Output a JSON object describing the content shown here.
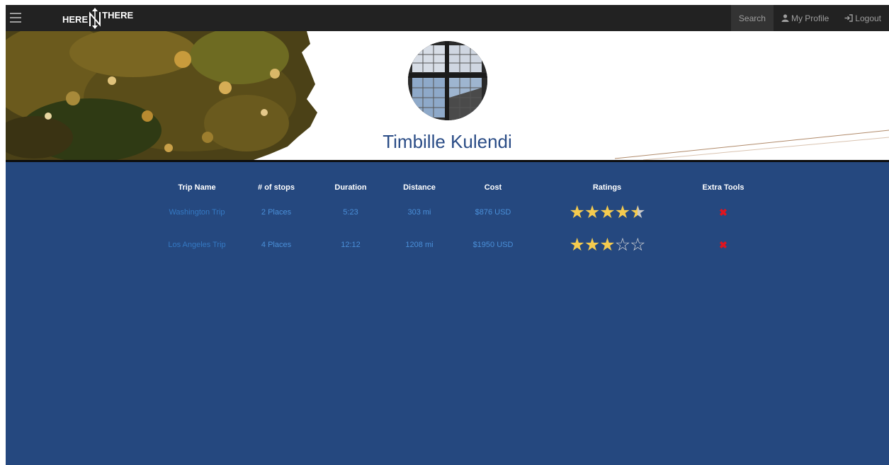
{
  "navbar": {
    "brand": {
      "left": "HERE",
      "right": "THERE"
    },
    "links": {
      "search": "Search",
      "profile": "My Profile",
      "logout": "Logout"
    }
  },
  "profile": {
    "name": "Timbille Kulendi"
  },
  "table": {
    "headers": [
      "Trip Name",
      "# of stops",
      "Duration",
      "Distance",
      "Cost",
      "Ratings",
      "Extra Tools"
    ],
    "rows": [
      {
        "name": "Washington Trip",
        "stops": "2 Places",
        "duration": "5:23",
        "distance": "303 mi",
        "cost": "$876 USD",
        "rating": 4.5
      },
      {
        "name": "Los Angeles Trip",
        "stops": "4 Places",
        "duration": "12:12",
        "distance": "1208 mi",
        "cost": "$1950 USD",
        "rating": 3
      }
    ]
  },
  "colors": {
    "navbar": "#222222",
    "content_bg": "#25487f",
    "profile_name": "#2a4c86",
    "link": "#4a8fd8",
    "star": "#f5cb4f",
    "delete": "#e0141e"
  },
  "icons": {
    "menu": "hamburger-icon",
    "profile": "user-icon",
    "logout": "login-arrow-icon",
    "rating": "star-icon",
    "delete": "red-x-icon"
  }
}
